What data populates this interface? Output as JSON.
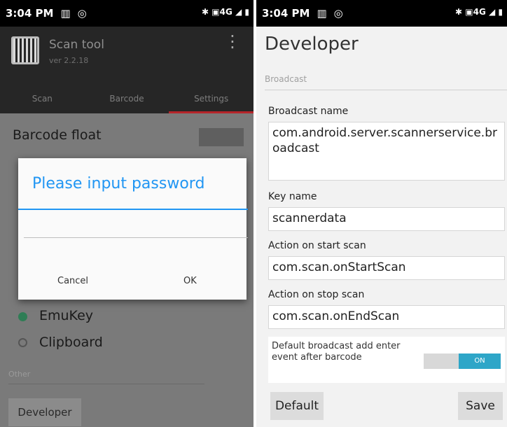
{
  "left": {
    "status": {
      "time": "3:04 PM",
      "right": "✱ ▣4G ◢ ▮"
    },
    "app": {
      "title": "Scan tool",
      "version": "ver 2.2.18"
    },
    "tabs": [
      "Scan",
      "Barcode",
      "Settings"
    ],
    "settings": {
      "barcode_float": "Barcode float",
      "options": [
        "EmuKey",
        "Clipboard"
      ],
      "other_label": "Other",
      "developer_button": "Developer"
    },
    "dialog": {
      "title": "Please input password",
      "cancel": "Cancel",
      "ok": "OK"
    }
  },
  "right": {
    "status": {
      "time": "3:04 PM",
      "right": "✱ ▣4G ◢ ▮"
    },
    "title": "Developer",
    "subtitle": "Broadcast",
    "fields": [
      {
        "label": "Broadcast name",
        "value": "com.android.server.scannerservice.broadcast"
      },
      {
        "label": "Key name",
        "value": "scannerdata"
      },
      {
        "label": "Action on start scan",
        "value": "com.scan.onStartScan"
      },
      {
        "label": "Action on stop scan",
        "value": "com.scan.onEndScan"
      }
    ],
    "toggle": {
      "text": "Default broadcast add enter event after barcode",
      "state": "ON"
    },
    "buttons": {
      "default": "Default",
      "save": "Save"
    }
  },
  "colors": {
    "accent": "#2196f3",
    "tab_indicator": "#b5252a",
    "toggle_on": "#2ea6c8"
  }
}
